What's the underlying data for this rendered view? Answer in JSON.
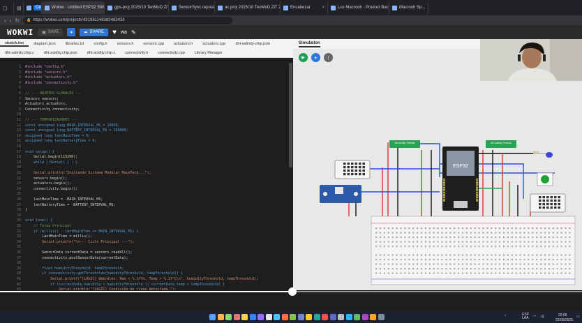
{
  "browser": {
    "tabs": [
      {
        "label": "Gmail",
        "badge": true
      },
      {
        "label": "Wokwi · Untitled ESP32 SIM Ej..."
      },
      {
        "label": "gps-proj 2025/10 TeoMoD.ZiT"
      },
      {
        "label": "SensorSync repository"
      },
      {
        "label": "ac.proj 2025/10 TeoMoD.ZiT 250i"
      },
      {
        "label": "Encabezar"
      },
      {
        "label": "Los Macrooh · Product Bac"
      },
      {
        "label": "Macrooh Sp..."
      }
    ],
    "url": "https://wokwi.com/projects/4319811463d34d3433"
  },
  "toolbar": {
    "logo": "WOKWI",
    "save_label": "SAVE",
    "share_label": "SHARE",
    "project_name": "wa"
  },
  "editor_tabs": {
    "row1": [
      "sketch.ino",
      "diagram.json",
      "libraries.txt",
      "config.h",
      "sensors.h",
      "sensors.cpp",
      "actuators.h",
      "actuators.cpp",
      "dht-salinity-chip.json"
    ],
    "row2": [
      "dht-salinity.chip.c",
      "dht-acidity.chip.json",
      "dht-acidity.chip.c",
      "connectivity.h",
      "connectivity.cpp",
      "Library Manager"
    ],
    "sim_tab": "Simulation"
  },
  "code": [
    {
      "n": "1",
      "t": "#include \"config.h\"",
      "c": "pp"
    },
    {
      "n": "2",
      "t": "#include \"sensors.h\"",
      "c": "pp"
    },
    {
      "n": "3",
      "t": "#include \"actuators.h\"",
      "c": "pp"
    },
    {
      "n": "4",
      "t": "#include \"connectivity.h\"",
      "c": "pp"
    },
    {
      "n": "5",
      "t": "",
      "c": ""
    },
    {
      "n": "6",
      "t": "// --- OBJETOS GLOBALES ---",
      "c": "cm"
    },
    {
      "n": "7",
      "t": "Sensors sensors;",
      "c": ""
    },
    {
      "n": "8",
      "t": "Actuators actuators;",
      "c": ""
    },
    {
      "n": "9",
      "t": "Connectivity connectivity;",
      "c": ""
    },
    {
      "n": "10",
      "t": "",
      "c": ""
    },
    {
      "n": "11",
      "t": "// --- TEMPORIZADORES ---",
      "c": "cm"
    },
    {
      "n": "12",
      "t": "const unsigned long MAIN_INTERVAL_MS = 10000;",
      "c": "kw"
    },
    {
      "n": "13",
      "t": "const unsigned long BATTERY_INTERVAL_MS = 300000;",
      "c": "kw"
    },
    {
      "n": "14",
      "t": "unsigned long lastMainTime = 0;",
      "c": "kw"
    },
    {
      "n": "15",
      "t": "unsigned long lastBatteryTime = 0;",
      "c": "kw"
    },
    {
      "n": "16",
      "t": "",
      "c": ""
    },
    {
      "n": "17",
      "t": "void setup() {",
      "c": "kw"
    },
    {
      "n": "18",
      "t": "    Serial.begin(115200);",
      "c": "fn"
    },
    {
      "n": "19",
      "t": "    while (!Serial) { ; }",
      "c": "kw"
    },
    {
      "n": "20",
      "t": "",
      "c": ""
    },
    {
      "n": "21",
      "t": "    Serial.println(\"Iniciando Sistema Modular MaceTech...\");",
      "c": "str"
    },
    {
      "n": "22",
      "t": "    sensors.begin();",
      "c": ""
    },
    {
      "n": "23",
      "t": "    actuators.begin();",
      "c": ""
    },
    {
      "n": "24",
      "t": "    connectivity.begin();",
      "c": ""
    },
    {
      "n": "25",
      "t": "",
      "c": ""
    },
    {
      "n": "26",
      "t": "    lastMainTime = -MAIN_INTERVAL_MS;",
      "c": ""
    },
    {
      "n": "27",
      "t": "    lastBatteryTime = -BATTERY_INTERVAL_MS;",
      "c": ""
    },
    {
      "n": "28",
      "t": "}",
      "c": ""
    },
    {
      "n": "29",
      "t": "",
      "c": ""
    },
    {
      "n": "30",
      "t": "void loop() {",
      "c": "kw"
    },
    {
      "n": "31",
      "t": "    // Tarea Principal",
      "c": "cm"
    },
    {
      "n": "32",
      "t": "    if (millis() - lastMainTime >= MAIN_INTERVAL_MS) {",
      "c": "kw"
    },
    {
      "n": "33",
      "t": "        lastMainTime = millis();",
      "c": ""
    },
    {
      "n": "34",
      "t": "        Serial.println(\"\\n--- Ciclo Principal ---\");",
      "c": "str"
    },
    {
      "n": "35",
      "t": "",
      "c": ""
    },
    {
      "n": "36",
      "t": "        SensorData currentData = sensors.readAll();",
      "c": ""
    },
    {
      "n": "37",
      "t": "        connectivity.postSensorData(currentData);",
      "c": ""
    },
    {
      "n": "38",
      "t": "",
      "c": ""
    },
    {
      "n": "39",
      "t": "        float humidityThreshold, tempThreshold;",
      "c": "kw"
    },
    {
      "n": "40",
      "t": "        if (connectivity.getThresholds(humidityThreshold, tempThreshold)) {",
      "c": "kw"
    },
    {
      "n": "41",
      "t": "            Serial.printf(\"[LOGIC] Umbrales: Hum < %.1f%%, Temp > %.1f°C\\n\", humidityThreshold, tempThreshold);",
      "c": "str"
    },
    {
      "n": "42",
      "t": "            if (currentData.humidity < humidityThreshold || currentData.temp > tempThreshold) {",
      "c": "kw"
    },
    {
      "n": "43",
      "t": "                Serial.println(\"[LOGIC] Condición de riego detectada.\");",
      "c": "str"
    }
  ],
  "simulation": {
    "chip_labels": [
      "dht-acidity Trmboal",
      "dht-salinity Trmboal"
    ],
    "board_label": "ESP32"
  },
  "video": {
    "progress": 0.502
  },
  "taskbar": {
    "lang": "ESP\nLAA",
    "time": "20:06",
    "date": "22/09/2025"
  },
  "colors": {
    "wire_red": "#d93a2b",
    "wire_blue": "#2a4fd8",
    "wire_black": "#111111",
    "wire_green": "#2fa84f",
    "board": "#1f1f1f",
    "sim_bg": "#e8e8e8"
  }
}
